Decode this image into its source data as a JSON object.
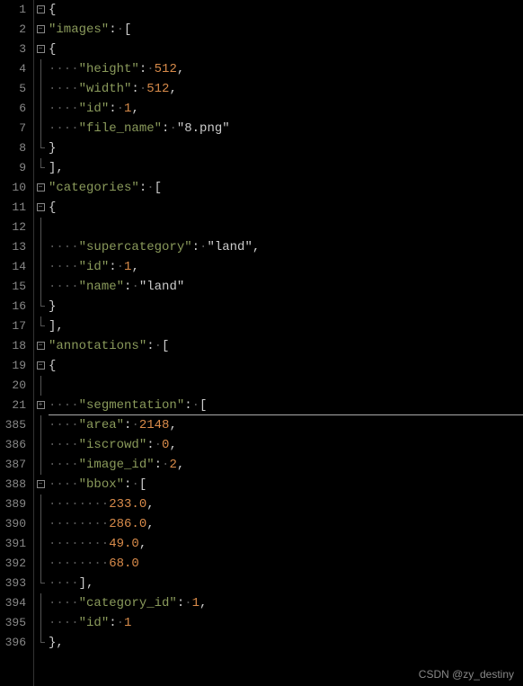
{
  "watermark": "CSDN @zy_destiny",
  "lines": [
    {
      "num": "1",
      "fold": "box",
      "content": [
        {
          "t": "brace",
          "v": "{"
        }
      ]
    },
    {
      "num": "2",
      "fold": "box",
      "content": [
        {
          "t": "key",
          "v": "\"images\""
        },
        {
          "t": "colon",
          "v": ":"
        },
        {
          "t": "dots",
          "v": "·"
        },
        {
          "t": "punct",
          "v": "["
        }
      ]
    },
    {
      "num": "3",
      "fold": "box",
      "content": [
        {
          "t": "brace",
          "v": "{"
        }
      ]
    },
    {
      "num": "4",
      "fold": "line",
      "content": [
        {
          "t": "dots",
          "v": "····"
        },
        {
          "t": "key",
          "v": "\"height\""
        },
        {
          "t": "colon",
          "v": ":"
        },
        {
          "t": "dots",
          "v": "·"
        },
        {
          "t": "num",
          "v": "512"
        },
        {
          "t": "punct",
          "v": ","
        }
      ]
    },
    {
      "num": "5",
      "fold": "line",
      "content": [
        {
          "t": "dots",
          "v": "····"
        },
        {
          "t": "key",
          "v": "\"width\""
        },
        {
          "t": "colon",
          "v": ":"
        },
        {
          "t": "dots",
          "v": "·"
        },
        {
          "t": "num",
          "v": "512"
        },
        {
          "t": "punct",
          "v": ","
        }
      ]
    },
    {
      "num": "6",
      "fold": "line",
      "content": [
        {
          "t": "dots",
          "v": "····"
        },
        {
          "t": "key",
          "v": "\"id\""
        },
        {
          "t": "colon",
          "v": ":"
        },
        {
          "t": "dots",
          "v": "·"
        },
        {
          "t": "num",
          "v": "1"
        },
        {
          "t": "punct",
          "v": ","
        }
      ]
    },
    {
      "num": "7",
      "fold": "line",
      "content": [
        {
          "t": "dots",
          "v": "····"
        },
        {
          "t": "key",
          "v": "\"file_name\""
        },
        {
          "t": "colon",
          "v": ":"
        },
        {
          "t": "dots",
          "v": "·"
        },
        {
          "t": "str",
          "v": "\"8.png\""
        }
      ]
    },
    {
      "num": "8",
      "fold": "end",
      "content": [
        {
          "t": "brace",
          "v": "}"
        }
      ]
    },
    {
      "num": "9",
      "fold": "end",
      "content": [
        {
          "t": "punct",
          "v": "],"
        }
      ]
    },
    {
      "num": "10",
      "fold": "box",
      "content": [
        {
          "t": "key",
          "v": "\"categories\""
        },
        {
          "t": "colon",
          "v": ":"
        },
        {
          "t": "dots",
          "v": "·"
        },
        {
          "t": "punct",
          "v": "["
        }
      ]
    },
    {
      "num": "11",
      "fold": "box",
      "content": [
        {
          "t": "brace",
          "v": "{"
        }
      ]
    },
    {
      "num": "12",
      "fold": "line",
      "content": []
    },
    {
      "num": "13",
      "fold": "line",
      "content": [
        {
          "t": "dots",
          "v": "····"
        },
        {
          "t": "key",
          "v": "\"supercategory\""
        },
        {
          "t": "colon",
          "v": ":"
        },
        {
          "t": "dots",
          "v": "·"
        },
        {
          "t": "str",
          "v": "\"land\""
        },
        {
          "t": "punct",
          "v": ","
        }
      ]
    },
    {
      "num": "14",
      "fold": "line",
      "content": [
        {
          "t": "dots",
          "v": "····"
        },
        {
          "t": "key",
          "v": "\"id\""
        },
        {
          "t": "colon",
          "v": ":"
        },
        {
          "t": "dots",
          "v": "·"
        },
        {
          "t": "num",
          "v": "1"
        },
        {
          "t": "punct",
          "v": ","
        }
      ]
    },
    {
      "num": "15",
      "fold": "line",
      "content": [
        {
          "t": "dots",
          "v": "····"
        },
        {
          "t": "key",
          "v": "\"name\""
        },
        {
          "t": "colon",
          "v": ":"
        },
        {
          "t": "dots",
          "v": "·"
        },
        {
          "t": "str",
          "v": "\"land\""
        }
      ]
    },
    {
      "num": "16",
      "fold": "end",
      "content": [
        {
          "t": "brace",
          "v": "}"
        }
      ]
    },
    {
      "num": "17",
      "fold": "end",
      "content": [
        {
          "t": "punct",
          "v": "],"
        }
      ]
    },
    {
      "num": "18",
      "fold": "box",
      "content": [
        {
          "t": "key",
          "v": "\"annotations\""
        },
        {
          "t": "colon",
          "v": ":"
        },
        {
          "t": "dots",
          "v": "·"
        },
        {
          "t": "punct",
          "v": "["
        }
      ]
    },
    {
      "num": "19",
      "fold": "box",
      "content": [
        {
          "t": "brace",
          "v": "{"
        }
      ]
    },
    {
      "num": "20",
      "fold": "line",
      "content": []
    },
    {
      "num": "21",
      "fold": "boxplus",
      "content": [
        {
          "t": "dots",
          "v": "····"
        },
        {
          "t": "key",
          "v": "\"segmentation\""
        },
        {
          "t": "colon",
          "v": ":"
        },
        {
          "t": "dots",
          "v": "·"
        },
        {
          "t": "punct",
          "v": "["
        }
      ],
      "hr": true
    },
    {
      "num": "385",
      "fold": "line",
      "content": [
        {
          "t": "dots",
          "v": "····"
        },
        {
          "t": "key",
          "v": "\"area\""
        },
        {
          "t": "colon",
          "v": ":"
        },
        {
          "t": "dots",
          "v": "·"
        },
        {
          "t": "num",
          "v": "2148"
        },
        {
          "t": "punct",
          "v": ","
        }
      ]
    },
    {
      "num": "386",
      "fold": "line",
      "content": [
        {
          "t": "dots",
          "v": "····"
        },
        {
          "t": "key",
          "v": "\"iscrowd\""
        },
        {
          "t": "colon",
          "v": ":"
        },
        {
          "t": "dots",
          "v": "·"
        },
        {
          "t": "num",
          "v": "0"
        },
        {
          "t": "punct",
          "v": ","
        }
      ]
    },
    {
      "num": "387",
      "fold": "line",
      "content": [
        {
          "t": "dots",
          "v": "····"
        },
        {
          "t": "key",
          "v": "\"image_id\""
        },
        {
          "t": "colon",
          "v": ":"
        },
        {
          "t": "dots",
          "v": "·"
        },
        {
          "t": "num",
          "v": "2"
        },
        {
          "t": "punct",
          "v": ","
        }
      ]
    },
    {
      "num": "388",
      "fold": "box",
      "content": [
        {
          "t": "dots",
          "v": "····"
        },
        {
          "t": "key",
          "v": "\"bbox\""
        },
        {
          "t": "colon",
          "v": ":"
        },
        {
          "t": "dots",
          "v": "·"
        },
        {
          "t": "punct",
          "v": "["
        }
      ]
    },
    {
      "num": "389",
      "fold": "line",
      "content": [
        {
          "t": "dots",
          "v": "········"
        },
        {
          "t": "num",
          "v": "233.0"
        },
        {
          "t": "punct",
          "v": ","
        }
      ]
    },
    {
      "num": "390",
      "fold": "line",
      "content": [
        {
          "t": "dots",
          "v": "········"
        },
        {
          "t": "num",
          "v": "286.0"
        },
        {
          "t": "punct",
          "v": ","
        }
      ]
    },
    {
      "num": "391",
      "fold": "line",
      "content": [
        {
          "t": "dots",
          "v": "········"
        },
        {
          "t": "num",
          "v": "49.0"
        },
        {
          "t": "punct",
          "v": ","
        }
      ]
    },
    {
      "num": "392",
      "fold": "line",
      "content": [
        {
          "t": "dots",
          "v": "········"
        },
        {
          "t": "num",
          "v": "68.0"
        }
      ]
    },
    {
      "num": "393",
      "fold": "end",
      "content": [
        {
          "t": "dots",
          "v": "····"
        },
        {
          "t": "punct",
          "v": "],"
        }
      ]
    },
    {
      "num": "394",
      "fold": "line",
      "content": [
        {
          "t": "dots",
          "v": "····"
        },
        {
          "t": "key",
          "v": "\"category_id\""
        },
        {
          "t": "colon",
          "v": ":"
        },
        {
          "t": "dots",
          "v": "·"
        },
        {
          "t": "num",
          "v": "1"
        },
        {
          "t": "punct",
          "v": ","
        }
      ]
    },
    {
      "num": "395",
      "fold": "line",
      "content": [
        {
          "t": "dots",
          "v": "····"
        },
        {
          "t": "key",
          "v": "\"id\""
        },
        {
          "t": "colon",
          "v": ":"
        },
        {
          "t": "dots",
          "v": "·"
        },
        {
          "t": "num",
          "v": "1"
        }
      ]
    },
    {
      "num": "396",
      "fold": "end",
      "content": [
        {
          "t": "brace",
          "v": "},"
        }
      ]
    }
  ]
}
